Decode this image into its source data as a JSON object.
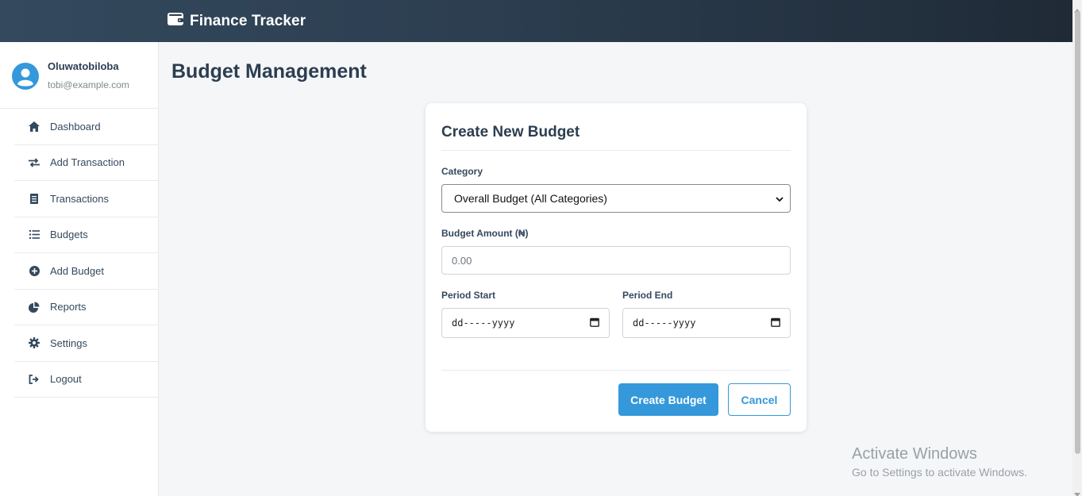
{
  "app": {
    "title": "Finance Tracker"
  },
  "user": {
    "name": "Oluwatobiloba",
    "email": "tobi@example.com"
  },
  "sidebar": {
    "items": [
      {
        "label": "Dashboard",
        "icon": "home-icon"
      },
      {
        "label": "Add Transaction",
        "icon": "exchange-icon"
      },
      {
        "label": "Transactions",
        "icon": "receipt-icon"
      },
      {
        "label": "Budgets",
        "icon": "list-icon"
      },
      {
        "label": "Add Budget",
        "icon": "plus-circle-icon"
      },
      {
        "label": "Reports",
        "icon": "pie-chart-icon"
      },
      {
        "label": "Settings",
        "icon": "gear-icon"
      },
      {
        "label": "Logout",
        "icon": "logout-icon"
      }
    ]
  },
  "page": {
    "title": "Budget Management"
  },
  "form": {
    "title": "Create New Budget",
    "category_label": "Category",
    "category_value": "Overall Budget (All Categories)",
    "amount_label": "Budget Amount (₦)",
    "amount_placeholder": "0.00",
    "period_start_label": "Period Start",
    "period_start_placeholder": "dd-----yyyy",
    "period_end_label": "Period End",
    "period_end_placeholder": "dd-----yyyy",
    "submit_label": "Create Budget",
    "cancel_label": "Cancel"
  },
  "watermark": {
    "title": "Activate Windows",
    "subtitle": "Go to Settings to activate Windows."
  },
  "colors": {
    "primary": "#3498db",
    "header_dark": "#2c3e50",
    "text_dark": "#2c3e50"
  }
}
